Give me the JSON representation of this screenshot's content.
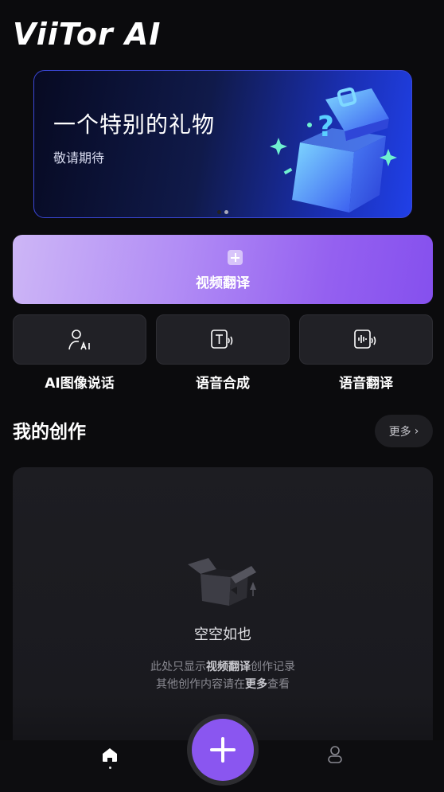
{
  "app": {
    "logo_text": "ViiTor AI"
  },
  "banner": {
    "title": "一个特别的礼物",
    "subtitle": "敬请期待",
    "page_count": 2,
    "active_page": 0
  },
  "primary_action": {
    "label": "视频翻译",
    "icon": "plus-icon"
  },
  "tools": [
    {
      "label": "AI图像说话",
      "icon": "ai-avatar-icon"
    },
    {
      "label": "语音合成",
      "icon": "text-to-speech-icon"
    },
    {
      "label": "语音翻译",
      "icon": "voice-translate-icon"
    }
  ],
  "my_works": {
    "title": "我的创作",
    "more_label": "更多",
    "empty_title": "空空如也",
    "hint_line1_prefix": "此处只显示",
    "hint_line1_bold": "视频翻译",
    "hint_line1_suffix": "创作记录",
    "hint_line2_prefix": "其他创作内容请在",
    "hint_line2_bold": "更多",
    "hint_line2_suffix": "查看"
  },
  "bottom_nav": {
    "items": [
      {
        "icon": "home-icon",
        "active": true
      },
      {
        "icon": "create-plus-icon"
      },
      {
        "icon": "profile-icon"
      }
    ]
  },
  "colors": {
    "background": "#0b0b0d",
    "accent_purple": "#8a56f0",
    "banner_blue": "#2040e8",
    "card": "#212126"
  }
}
